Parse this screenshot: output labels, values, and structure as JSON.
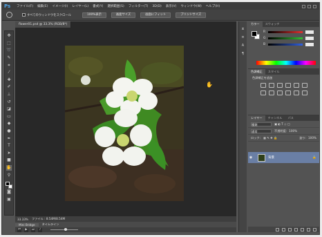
{
  "app": {
    "logo": "Ps"
  },
  "menu": [
    "ファイル(F)",
    "編集(E)",
    "イメージ(I)",
    "レイヤー(L)",
    "書式(Y)",
    "選択範囲(S)",
    "フィルター(T)",
    "3D(D)",
    "表示(V)",
    "ウィンドウ(W)",
    "ヘルプ(H)"
  ],
  "options": {
    "scroll_all_label": "すべてのウィンドウをスクロール",
    "buttons": [
      "100%表示",
      "画面サイズ",
      "画面にフィット",
      "プリントサイズ"
    ]
  },
  "document": {
    "tab_label": "flower01.psd @ 33.3% (RGB/8*)",
    "zoom": "33.33%",
    "doc_info": "ファイル : 8.54M/8.54M"
  },
  "timeline": {
    "tabs": [
      "Mini Bridge",
      "タイムライン"
    ]
  },
  "panels": {
    "color_tabs": [
      "カラー",
      "スウォッチ"
    ],
    "slider_labels": [
      "R",
      "G",
      "B"
    ],
    "slider_colors": [
      "#e03030",
      "#30c030",
      "#3060e0"
    ],
    "adjust_tabs": [
      "色調補正",
      "スタイル"
    ],
    "adjust_title": "色調補正を追加",
    "layer_tabs": [
      "レイヤー",
      "チャンネル",
      "パス"
    ],
    "kind_label": "種類",
    "blend_mode": "通常",
    "opacity_label": "不透明度:",
    "opacity": "100%",
    "lock_label": "ロック:",
    "fill_label": "塗り:",
    "fill": "100%",
    "layer_name": "背景"
  }
}
